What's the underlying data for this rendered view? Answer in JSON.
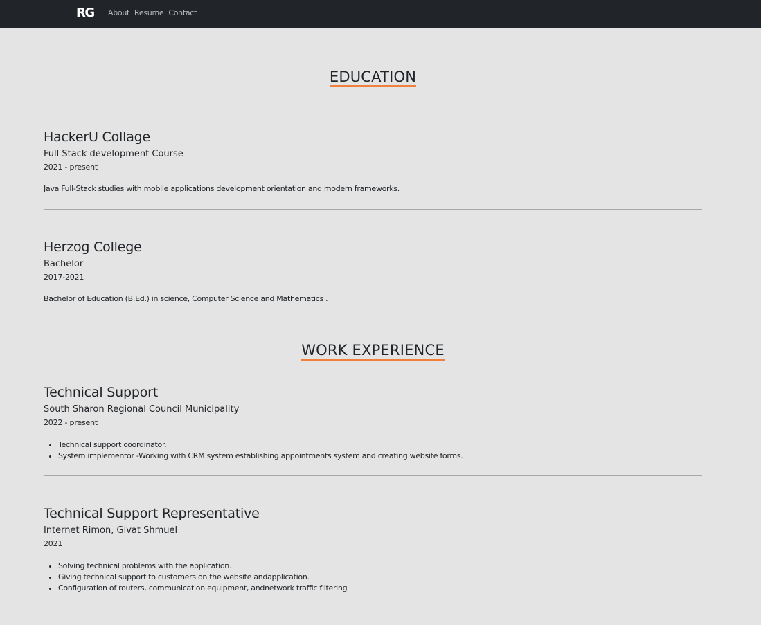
{
  "nav": {
    "brand": "RG",
    "links": [
      "About",
      "Resume",
      "Contact"
    ]
  },
  "education": {
    "title": "EDUCATION",
    "entries": [
      {
        "institution": "HackerU Collage",
        "program": "Full Stack development Course",
        "date": "2021 - present",
        "description": "Java Full-Stack studies with mobile applications development orientation and modern frameworks."
      },
      {
        "institution": "Herzog College",
        "program": "Bachelor",
        "date": "2017-2021",
        "description": "Bachelor of Education (B.Ed.) in science, Computer Science and Mathematics ."
      }
    ]
  },
  "work": {
    "title": "WORK EXPERIENCE",
    "entries": [
      {
        "role": "Technical Support",
        "company": "South Sharon Regional Council Municipality",
        "date": "2022 - present",
        "bullets": [
          "Technical support coordinator.",
          "System implementor -Working with CRM system establishing.appointments system and creating website forms."
        ]
      },
      {
        "role": "Technical Support Representative",
        "company": "Internet Rimon, Givat Shmuel",
        "date": "2021",
        "bullets": [
          "Solving technical problems with the application.",
          "Giving technical support to customers on the website andapplication.",
          "Configuration of routers, communication equipment, andnetwork traffic filtering"
        ]
      }
    ]
  },
  "colors": {
    "navbar": "#212529",
    "background": "#e4e4e4",
    "accent_underline": "#f0803c",
    "divider": "#a8a8a8"
  }
}
